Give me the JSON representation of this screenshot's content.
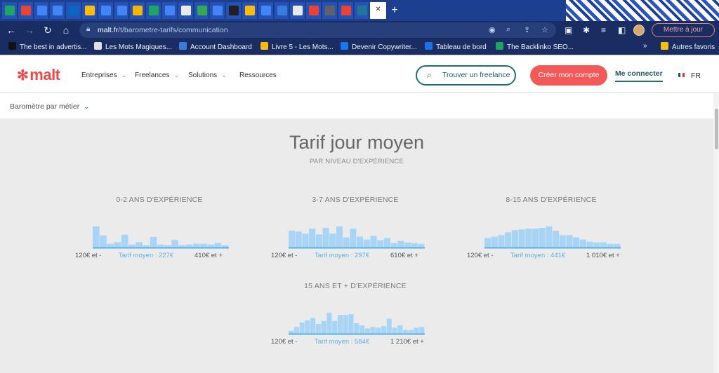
{
  "browser": {
    "tabs": [
      {
        "icon": "green-plus-icon",
        "color": "#1fa463"
      },
      {
        "icon": "gmail-icon",
        "color": "#ea4335"
      },
      {
        "icon": "docs-icon",
        "color": "#4285f4"
      },
      {
        "icon": "docs-icon",
        "color": "#4285f4"
      },
      {
        "icon": "linkedin-icon",
        "color": "#0a66c2"
      },
      {
        "icon": "drive-icon",
        "color": "#fbbc05"
      },
      {
        "icon": "docs-icon",
        "color": "#4285f4"
      },
      {
        "icon": "docs-icon",
        "color": "#4285f4"
      },
      {
        "icon": "slides-icon",
        "color": "#f4b400"
      },
      {
        "icon": "green-plus-icon",
        "color": "#1fa463"
      },
      {
        "icon": "docs-icon",
        "color": "#4285f4"
      },
      {
        "icon": "page-icon",
        "color": "#e9e9e9"
      },
      {
        "icon": "chrome-icon",
        "color": "#34a853"
      },
      {
        "icon": "docs-icon",
        "color": "#4285f4"
      },
      {
        "icon": "dark-page-icon",
        "color": "#202020"
      },
      {
        "icon": "drive-icon",
        "color": "#fbbc05"
      },
      {
        "icon": "docs-icon",
        "color": "#4285f4"
      },
      {
        "icon": "link-icon",
        "color": "#3a7be0"
      },
      {
        "icon": "page-icon",
        "color": "#e9e9e9"
      },
      {
        "icon": "gmail-icon",
        "color": "#ea4335"
      },
      {
        "icon": "globe-icon",
        "color": "#5f6368"
      },
      {
        "icon": "circle-icon",
        "color": "#ea4335"
      },
      {
        "icon": "wordpress-icon",
        "color": "#21759b"
      }
    ],
    "active_tab_close": "✕",
    "new_tab": "+",
    "url_host": "malt.fr",
    "url_path": "/t/barometre-tarifs/communication",
    "update_label": "Mettre à jour",
    "bookmarks": [
      {
        "label": "The best in advertis...",
        "icon": "bookmark-icon",
        "color": "#111111"
      },
      {
        "label": "Les Mots Magiques...",
        "icon": "bookmark-icon",
        "color": "#e0e0e0"
      },
      {
        "label": "Account Dashboard",
        "icon": "globe-icon",
        "color": "#3a7be0"
      },
      {
        "label": "Livre 5 - Les Mots...",
        "icon": "drive-icon",
        "color": "#fbbc05"
      },
      {
        "label": "Devenir Copywriter...",
        "icon": "facebook-icon",
        "color": "#1877f2"
      },
      {
        "label": "Tableau de bord",
        "icon": "s-icon",
        "color": "#1a73e8"
      },
      {
        "label": "The Backlinko SEO...",
        "icon": "circle-icon",
        "color": "#1ea362"
      }
    ],
    "bookmarks_more": "»",
    "other_bookmarks": "Autres favoris"
  },
  "site": {
    "logo": "malt",
    "nav": [
      "Entreprises",
      "Freelances",
      "Solutions",
      "Ressources"
    ],
    "find_freelance": "Trouver un freelance",
    "create_account": "Créer mon compte",
    "login": "Me connecter",
    "language": "FR",
    "accent_color": "#f35959",
    "teal_color": "#1f6f78"
  },
  "subnav": {
    "label": "Baromètre par métier"
  },
  "main": {
    "title": "Tarif jour moyen",
    "subtitle": "PAR NIVEAU D'EXPÉRIENCE"
  },
  "chart_data": [
    {
      "type": "bar",
      "title": "0-2 ANS D'EXPÉRIENCE",
      "min_label": "120€ et -",
      "avg_label": "Tarif moyen : 227€",
      "max_label": "410€ et +",
      "values": [
        28,
        16,
        5,
        7,
        17,
        4,
        7,
        3,
        14,
        4,
        3,
        10,
        3,
        4,
        5,
        5,
        4,
        6,
        3
      ],
      "bar_color": "#a8d4f5"
    },
    {
      "type": "bar",
      "title": "3-7 ANS D'EXPÉRIENCE",
      "min_label": "120€ et -",
      "avg_label": "Tarif moyen : 297€",
      "max_label": "610€ et +",
      "values": [
        23,
        22,
        19,
        26,
        18,
        27,
        19,
        29,
        14,
        26,
        15,
        11,
        16,
        10,
        13,
        6,
        9,
        7,
        6,
        5
      ],
      "bar_color": "#a8d4f5"
    },
    {
      "type": "bar",
      "title": "8-15 ANS D'EXPÉRIENCE",
      "min_label": "120€ et -",
      "avg_label": "Tarif moyen : 441€",
      "max_label": "1 010€ et +",
      "values": [
        13,
        15,
        17,
        21,
        24,
        25,
        26,
        26,
        27,
        29,
        23,
        17,
        17,
        14,
        11,
        8,
        7,
        7,
        5,
        5
      ],
      "bar_color": "#a8d4f5"
    },
    {
      "type": "bar",
      "title": "15 ANS ET + D'EXPÉRIENCE",
      "min_label": "120€ et -",
      "avg_label": "Tarif moyen : 584€",
      "max_label": "1 210€ et +",
      "values": [
        4,
        9,
        15,
        18,
        21,
        13,
        17,
        28,
        17,
        25,
        25,
        26,
        14,
        11,
        7,
        9,
        8,
        10,
        20,
        8,
        11,
        5,
        5,
        8,
        9
      ],
      "bar_color": "#a8d4f5"
    }
  ]
}
